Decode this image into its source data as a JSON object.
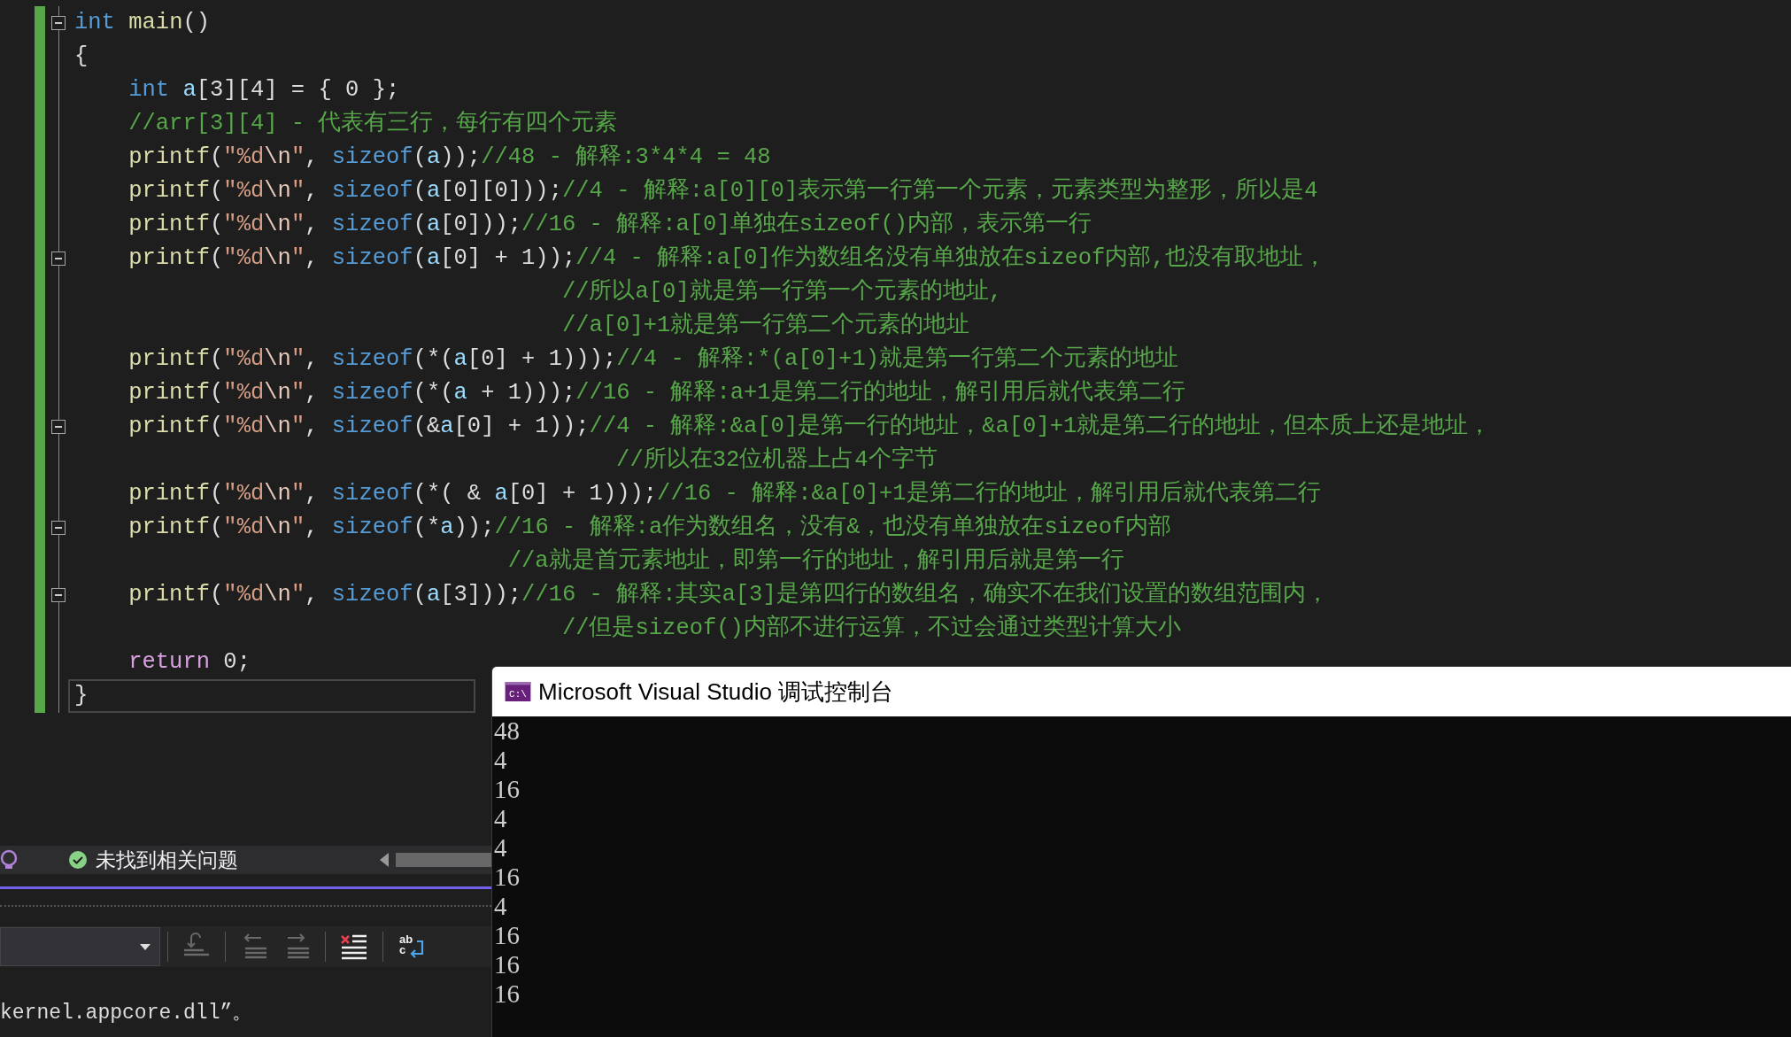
{
  "editor": {
    "lines": [
      {
        "tokens": [
          {
            "kind": "keyword",
            "text": "int"
          },
          {
            "kind": "function",
            "text": " main"
          },
          {
            "kind": "plain",
            "text": "()"
          }
        ],
        "foldable": true,
        "current": false
      },
      {
        "tokens": [
          {
            "kind": "plain",
            "text": "{"
          }
        ],
        "foldable": false,
        "current": false
      },
      {
        "tokens": [
          {
            "kind": "keyword",
            "text": "    int"
          },
          {
            "kind": "variable",
            "text": " a"
          },
          {
            "kind": "plain",
            "text": "[3][4] = { 0 };"
          }
        ],
        "foldable": false,
        "current": false
      },
      {
        "tokens": [
          {
            "kind": "comment",
            "text": "    //arr[3][4] - 代表有三行，每行有四个元素"
          }
        ],
        "foldable": false,
        "current": false
      },
      {
        "tokens": [
          {
            "kind": "function",
            "text": "    printf"
          },
          {
            "kind": "plain",
            "text": "("
          },
          {
            "kind": "string",
            "text": "\"%d"
          },
          {
            "kind": "escape",
            "text": "\\n"
          },
          {
            "kind": "string",
            "text": "\""
          },
          {
            "kind": "plain",
            "text": ", "
          },
          {
            "kind": "keyword",
            "text": "sizeof"
          },
          {
            "kind": "plain",
            "text": "("
          },
          {
            "kind": "variable",
            "text": "a"
          },
          {
            "kind": "plain",
            "text": "));"
          },
          {
            "kind": "comment",
            "text": "//48 - 解释:3*4*4 = 48"
          }
        ],
        "foldable": false,
        "current": false
      },
      {
        "tokens": [
          {
            "kind": "function",
            "text": "    printf"
          },
          {
            "kind": "plain",
            "text": "("
          },
          {
            "kind": "string",
            "text": "\"%d"
          },
          {
            "kind": "escape",
            "text": "\\n"
          },
          {
            "kind": "string",
            "text": "\""
          },
          {
            "kind": "plain",
            "text": ", "
          },
          {
            "kind": "keyword",
            "text": "sizeof"
          },
          {
            "kind": "plain",
            "text": "("
          },
          {
            "kind": "variable",
            "text": "a"
          },
          {
            "kind": "plain",
            "text": "[0][0]));"
          },
          {
            "kind": "comment",
            "text": "//4 - 解释:a[0][0]表示第一行第一个元素，元素类型为整形，所以是4"
          }
        ],
        "foldable": false,
        "current": false
      },
      {
        "tokens": [
          {
            "kind": "function",
            "text": "    printf"
          },
          {
            "kind": "plain",
            "text": "("
          },
          {
            "kind": "string",
            "text": "\"%d"
          },
          {
            "kind": "escape",
            "text": "\\n"
          },
          {
            "kind": "string",
            "text": "\""
          },
          {
            "kind": "plain",
            "text": ", "
          },
          {
            "kind": "keyword",
            "text": "sizeof"
          },
          {
            "kind": "plain",
            "text": "("
          },
          {
            "kind": "variable",
            "text": "a"
          },
          {
            "kind": "plain",
            "text": "[0]));"
          },
          {
            "kind": "comment",
            "text": "//16 - 解释:a[0]单独在sizeof()内部，表示第一行"
          }
        ],
        "foldable": false,
        "current": false
      },
      {
        "tokens": [
          {
            "kind": "function",
            "text": "    printf"
          },
          {
            "kind": "plain",
            "text": "("
          },
          {
            "kind": "string",
            "text": "\"%d"
          },
          {
            "kind": "escape",
            "text": "\\n"
          },
          {
            "kind": "string",
            "text": "\""
          },
          {
            "kind": "plain",
            "text": ", "
          },
          {
            "kind": "keyword",
            "text": "sizeof"
          },
          {
            "kind": "plain",
            "text": "("
          },
          {
            "kind": "variable",
            "text": "a"
          },
          {
            "kind": "plain",
            "text": "[0] + 1));"
          },
          {
            "kind": "comment",
            "text": "//4 - 解释:a[0]作为数组名没有单独放在sizeof内部,也没有取地址，"
          }
        ],
        "foldable": true,
        "current": false
      },
      {
        "tokens": [
          {
            "kind": "comment",
            "text": "                                    //所以a[0]就是第一行第一个元素的地址,"
          }
        ],
        "foldable": false,
        "current": false
      },
      {
        "tokens": [
          {
            "kind": "comment",
            "text": "                                    //a[0]+1就是第一行第二个元素的地址"
          }
        ],
        "foldable": false,
        "current": false
      },
      {
        "tokens": [
          {
            "kind": "function",
            "text": "    printf"
          },
          {
            "kind": "plain",
            "text": "("
          },
          {
            "kind": "string",
            "text": "\"%d"
          },
          {
            "kind": "escape",
            "text": "\\n"
          },
          {
            "kind": "string",
            "text": "\""
          },
          {
            "kind": "plain",
            "text": ", "
          },
          {
            "kind": "keyword",
            "text": "sizeof"
          },
          {
            "kind": "plain",
            "text": "(*("
          },
          {
            "kind": "variable",
            "text": "a"
          },
          {
            "kind": "plain",
            "text": "[0] + 1)));"
          },
          {
            "kind": "comment",
            "text": "//4 - 解释:*(a[0]+1)就是第一行第二个元素的地址"
          }
        ],
        "foldable": false,
        "current": false
      },
      {
        "tokens": [
          {
            "kind": "function",
            "text": "    printf"
          },
          {
            "kind": "plain",
            "text": "("
          },
          {
            "kind": "string",
            "text": "\"%d"
          },
          {
            "kind": "escape",
            "text": "\\n"
          },
          {
            "kind": "string",
            "text": "\""
          },
          {
            "kind": "plain",
            "text": ", "
          },
          {
            "kind": "keyword",
            "text": "sizeof"
          },
          {
            "kind": "plain",
            "text": "(*("
          },
          {
            "kind": "variable",
            "text": "a"
          },
          {
            "kind": "plain",
            "text": " + 1)));"
          },
          {
            "kind": "comment",
            "text": "//16 - 解释:a+1是第二行的地址，解引用后就代表第二行"
          }
        ],
        "foldable": false,
        "current": false
      },
      {
        "tokens": [
          {
            "kind": "function",
            "text": "    printf"
          },
          {
            "kind": "plain",
            "text": "("
          },
          {
            "kind": "string",
            "text": "\"%d"
          },
          {
            "kind": "escape",
            "text": "\\n"
          },
          {
            "kind": "string",
            "text": "\""
          },
          {
            "kind": "plain",
            "text": ", "
          },
          {
            "kind": "keyword",
            "text": "sizeof"
          },
          {
            "kind": "plain",
            "text": "(&"
          },
          {
            "kind": "variable",
            "text": "a"
          },
          {
            "kind": "plain",
            "text": "[0] + 1));"
          },
          {
            "kind": "comment",
            "text": "//4 - 解释:&a[0]是第一行的地址，&a[0]+1就是第二行的地址，但本质上还是地址，"
          }
        ],
        "foldable": true,
        "current": false
      },
      {
        "tokens": [
          {
            "kind": "comment",
            "text": "                                        //所以在32位机器上占4个字节"
          }
        ],
        "foldable": false,
        "current": false
      },
      {
        "tokens": [
          {
            "kind": "function",
            "text": "    printf"
          },
          {
            "kind": "plain",
            "text": "("
          },
          {
            "kind": "string",
            "text": "\"%d"
          },
          {
            "kind": "escape",
            "text": "\\n"
          },
          {
            "kind": "string",
            "text": "\""
          },
          {
            "kind": "plain",
            "text": ", "
          },
          {
            "kind": "keyword",
            "text": "sizeof"
          },
          {
            "kind": "plain",
            "text": "(*( & "
          },
          {
            "kind": "variable",
            "text": "a"
          },
          {
            "kind": "plain",
            "text": "[0] + 1)));"
          },
          {
            "kind": "comment",
            "text": "//16 - 解释:&a[0]+1是第二行的地址，解引用后就代表第二行"
          }
        ],
        "foldable": false,
        "current": false
      },
      {
        "tokens": [
          {
            "kind": "function",
            "text": "    printf"
          },
          {
            "kind": "plain",
            "text": "("
          },
          {
            "kind": "string",
            "text": "\"%d"
          },
          {
            "kind": "escape",
            "text": "\\n"
          },
          {
            "kind": "string",
            "text": "\""
          },
          {
            "kind": "plain",
            "text": ", "
          },
          {
            "kind": "keyword",
            "text": "sizeof"
          },
          {
            "kind": "plain",
            "text": "(*"
          },
          {
            "kind": "variable",
            "text": "a"
          },
          {
            "kind": "plain",
            "text": "));"
          },
          {
            "kind": "comment",
            "text": "//16 - 解释:a作为数组名，没有&，也没有单独放在sizeof内部"
          }
        ],
        "foldable": true,
        "current": false
      },
      {
        "tokens": [
          {
            "kind": "comment",
            "text": "                                //a就是首元素地址，即第一行的地址，解引用后就是第一行"
          }
        ],
        "foldable": false,
        "current": false
      },
      {
        "tokens": [
          {
            "kind": "function",
            "text": "    printf"
          },
          {
            "kind": "plain",
            "text": "("
          },
          {
            "kind": "string",
            "text": "\"%d"
          },
          {
            "kind": "escape",
            "text": "\\n"
          },
          {
            "kind": "string",
            "text": "\""
          },
          {
            "kind": "plain",
            "text": ", "
          },
          {
            "kind": "keyword",
            "text": "sizeof"
          },
          {
            "kind": "plain",
            "text": "("
          },
          {
            "kind": "variable",
            "text": "a"
          },
          {
            "kind": "plain",
            "text": "[3]));"
          },
          {
            "kind": "comment",
            "text": "//16 - 解释:其实a[3]是第四行的数组名，确实不在我们设置的数组范围内，"
          }
        ],
        "foldable": true,
        "current": false
      },
      {
        "tokens": [
          {
            "kind": "comment",
            "text": "                                    //但是sizeof()内部不进行运算，不过会通过类型计算大小"
          }
        ],
        "foldable": false,
        "current": false
      },
      {
        "tokens": [
          {
            "kind": "control",
            "text": "    return"
          },
          {
            "kind": "plain",
            "text": " 0;"
          }
        ],
        "foldable": false,
        "current": false
      },
      {
        "tokens": [
          {
            "kind": "plain",
            "text": "}"
          }
        ],
        "foldable": false,
        "current": true
      }
    ]
  },
  "status_bar": {
    "message": "未找到相关问题"
  },
  "output_panel": {
    "toolbar": [
      {
        "kind": "goto",
        "disabled": true
      },
      {
        "kind": "prev",
        "disabled": true
      },
      {
        "kind": "next",
        "disabled": true
      },
      {
        "kind": "clear",
        "disabled": false
      },
      {
        "kind": "wrap",
        "disabled": false,
        "icon_text": [
          "ab",
          "c"
        ]
      }
    ],
    "lines": [
      "kernel.appcore.dll”。"
    ]
  },
  "console": {
    "title": "Microsoft Visual Studio 调试控制台",
    "icon_text": "C:\\",
    "output": [
      "48",
      "4",
      "16",
      "4",
      "4",
      "16",
      "4",
      "16",
      "16",
      "16"
    ]
  }
}
